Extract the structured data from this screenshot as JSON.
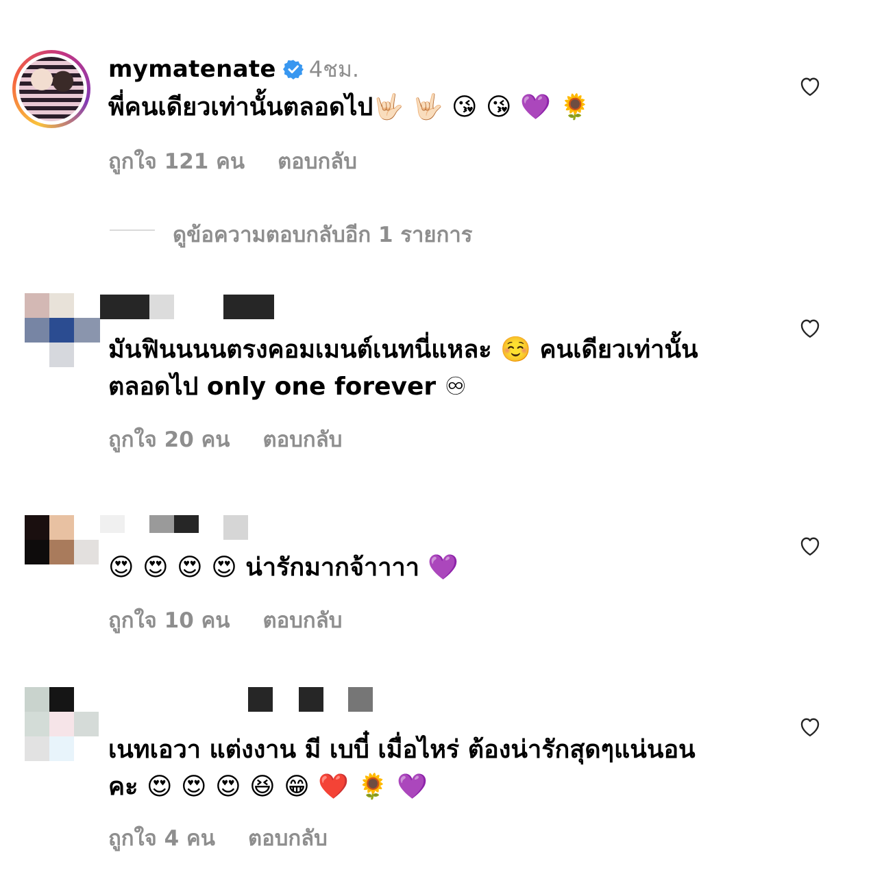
{
  "comments": [
    {
      "username": "mymatenate",
      "verified": true,
      "time": "4ชม.",
      "text": "พี่คนเดียวเท่านั้นตลอดไป🤟🏻 🤟🏻 😘 😘 💜 🌻",
      "likes": "ถูกใจ 121 คน",
      "reply": "ตอบกลับ",
      "view_replies": "ดูข้อความตอบกลับอีก 1 รายการ"
    },
    {
      "text_line1": "มันฟินนนนตรงคอมเมนต์เนทนี่แหละ ☺️ คนเดียวเท่านั้น",
      "text_line2": "ตลอดไป only one forever ♾",
      "likes": "ถูกใจ 20 คน",
      "reply": "ตอบกลับ"
    },
    {
      "text": "😍 😍 😍 😍 น่ารักมากจ้าาาา 💜",
      "likes": "ถูกใจ 10 คน",
      "reply": "ตอบกลับ"
    },
    {
      "text_line1": "เนทเอวา แต่งงาน มี เบบี๋ เมื่อไหร่ ต้องน่ารักสุดๆแน่นอน",
      "text_line2": "คะ 😍 😍 😍  😆 😁 ❤️ 🌻 💜",
      "likes": "ถูกใจ 4 คน",
      "reply": "ตอบกลับ"
    }
  ],
  "icons": {
    "like": "heart-outline-icon",
    "verified": "verified-badge-icon"
  },
  "colors": {
    "secondary_text": "#8e8e8e",
    "verified_blue": "#3897f0",
    "separator": "#d9d9d9"
  }
}
